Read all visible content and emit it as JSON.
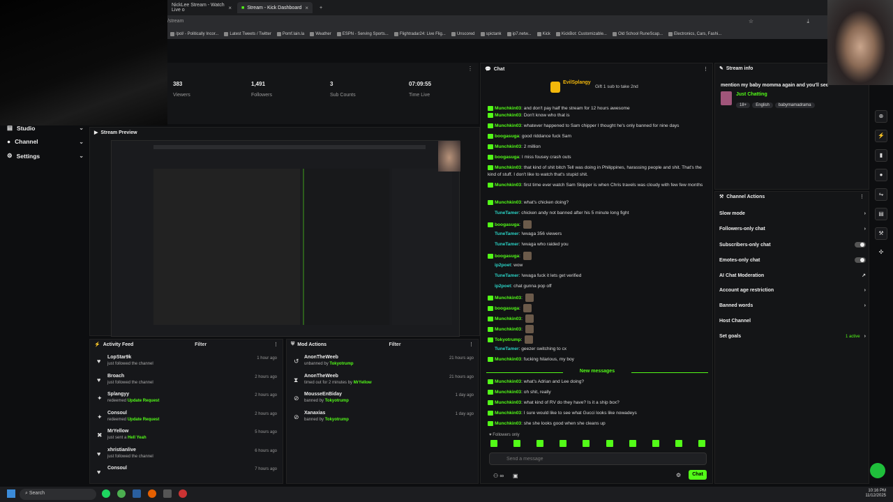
{
  "browser": {
    "tabs": [
      {
        "title": "NickLee Stream - Watch Live o"
      },
      {
        "title": "Stream - Kick Dashboard"
      }
    ],
    "url": "/stream",
    "bookmarks": [
      "/pol/ - Politically Incor...",
      "Latest Tweets / Twitter",
      "Pomf.lain.la",
      "Weather",
      "ESPN - Serving Sports...",
      "Flightradar24: Live Flig...",
      "Unscored",
      "spictank",
      "ip7.netw...",
      "Kick",
      "KickBot: Customizable...",
      "Old School RuneScap...",
      "Electronics, Cars, Fashi..."
    ]
  },
  "sidebar": {
    "items": [
      {
        "label": "Studio"
      },
      {
        "label": "Channel"
      },
      {
        "label": "Settings"
      }
    ]
  },
  "stats": [
    {
      "value": "383",
      "label": "Viewers"
    },
    {
      "value": "1,491",
      "label": "Followers"
    },
    {
      "value": "3",
      "label": "Sub Counts"
    },
    {
      "value": "07:09:55",
      "label": "Time Live"
    }
  ],
  "preview": {
    "title": "Stream Preview"
  },
  "activity": {
    "title": "Activity Feed",
    "filter": "Filter",
    "items": [
      {
        "name": "LopStar9k",
        "action": "just followed the channel",
        "time": "1 hour ago",
        "icon": "heart-icon",
        "glyph": "♥"
      },
      {
        "name": "Broach",
        "action": "just followed the channel",
        "time": "2 hours ago",
        "icon": "heart-icon",
        "glyph": "♥"
      },
      {
        "name": "Splangyy",
        "action": "redeemed",
        "highlight": "Update Request",
        "time": "2 hours ago",
        "icon": "redeem-icon",
        "glyph": "✦"
      },
      {
        "name": "Consoul",
        "action": "redeemed",
        "highlight": "Update Request",
        "time": "2 hours ago",
        "icon": "redeem-icon",
        "glyph": "✦"
      },
      {
        "name": "MrYellow",
        "action": "just sent a",
        "highlight": "Hell Yeah",
        "time": "5 hours ago",
        "icon": "gift-icon",
        "glyph": "✖"
      },
      {
        "name": "xhristianlive",
        "action": "just followed the channel",
        "time": "6 hours ago",
        "icon": "heart-icon",
        "glyph": "♥"
      },
      {
        "name": "Consoul",
        "action": "",
        "time": "7 hours ago",
        "icon": "heart-icon",
        "glyph": "♥"
      }
    ]
  },
  "modactions": {
    "title": "Mod Actions",
    "filter": "Filter",
    "items": [
      {
        "name": "AnonTheWeeb",
        "action": "unbanned by",
        "by": "Tokyotrump",
        "time": "21 hours ago",
        "icon": "undo-icon",
        "glyph": "↺"
      },
      {
        "name": "AnonTheWeeb",
        "action": "timed out for 2 minutes by",
        "by": "MrYellow",
        "time": "21 hours ago",
        "icon": "hourglass-icon",
        "glyph": "⧗"
      },
      {
        "name": "MousseEnBiday",
        "action": "banned by",
        "by": "Tokyotrump",
        "time": "1 day ago",
        "icon": "ban-icon",
        "glyph": "⊘"
      },
      {
        "name": "Xanaxias",
        "action": "banned by",
        "by": "Tokyotrump",
        "time": "1 day ago",
        "icon": "ban-icon",
        "glyph": "⊘"
      }
    ]
  },
  "chat": {
    "title": "Chat",
    "pinned_user": "EvilSplangy",
    "pinned_text": "Gift 1 sub to take 2nd",
    "messages": [
      {
        "user": "Munchkin03",
        "text": "and don't pay half the stream for 12 hours awesome",
        "color": "#53fc18"
      },
      {
        "user": "Munchkin03",
        "text": "Don't know who that is",
        "color": "#53fc18"
      },
      {
        "user": "Munchkin03",
        "text": "whatever happened to Sam chipper I thought he's only banned for nine days",
        "color": "#53fc18"
      },
      {
        "user": "boogasuga",
        "text": "good riddance fuck Sam",
        "color": "#53fc18"
      },
      {
        "user": "Munchkin03",
        "text": "2 million",
        "color": "#53fc18"
      },
      {
        "user": "boogasuga",
        "text": "I miss fousey crash outs",
        "color": "#53fc18"
      },
      {
        "user": "Munchkin03",
        "text": "that kind of shit bitch Tell was doing in Philippines, harassing people and shit. That's the kind of stuff. I don't like to watch that's stupid shit.",
        "color": "#53fc18"
      },
      {
        "user": "Munchkin03",
        "text": "first time ever watch Sam Skipper is when Chris travels was cloudy with few few months",
        "color": "#53fc18"
      },
      {
        "user": "Munchkin03",
        "text": "what's chicken doing?",
        "color": "#53fc18"
      },
      {
        "user": "TuneTamer",
        "text": "chicken andy not banned after his 5 minute long fight",
        "color": "#2bd4c7"
      },
      {
        "user": "boogasuga",
        "text": "",
        "color": "#53fc18"
      },
      {
        "user": "TuneTamer",
        "text": "!wvaga 356 viewers",
        "color": "#2bd4c7"
      },
      {
        "user": "TuneTamer",
        "text": "!wvaga who raided you",
        "color": "#2bd4c7"
      },
      {
        "user": "boogasuga",
        "text": "",
        "color": "#53fc18"
      },
      {
        "user": "ip2poet",
        "text": "wow",
        "color": "#2bd4c7"
      },
      {
        "user": "TuneTamer",
        "text": "!wvaga fuck it lets get verified",
        "color": "#2bd4c7"
      },
      {
        "user": "ip2poet",
        "text": "chat gunna pop off",
        "color": "#2bd4c7"
      },
      {
        "user": "Munchkin03",
        "text": "",
        "color": "#53fc18"
      },
      {
        "user": "boogasuga",
        "text": "",
        "color": "#53fc18"
      },
      {
        "user": "Munchkin03",
        "text": "",
        "color": "#53fc18"
      },
      {
        "user": "Munchkin03",
        "text": "",
        "color": "#53fc18"
      },
      {
        "user": "Tokyotrump",
        "text": "",
        "color": "#53fc18"
      },
      {
        "user": "TuneTamer",
        "text": "geezer switching to cx",
        "color": "#2bd4c7"
      },
      {
        "user": "Munchkin03",
        "text": "fucking hilarious, my boy",
        "color": "#53fc18"
      }
    ],
    "new_label": "New messages",
    "new_messages": [
      {
        "user": "Munchkin03",
        "text": "what's Adrian and Lee doing?",
        "color": "#53fc18"
      },
      {
        "user": "Munchkin03",
        "text": "oh shit, really",
        "color": "#53fc18"
      },
      {
        "user": "Munchkin03",
        "text": "what kind of RV do they have? Is it a ship box?",
        "color": "#53fc18"
      },
      {
        "user": "Munchkin03",
        "text": "I sure would like to see what Gucci looks like nowadeys",
        "color": "#53fc18"
      },
      {
        "user": "Munchkin03",
        "text": "she she looks good when she cleans up",
        "color": "#53fc18"
      }
    ],
    "followers_only": "Followers only",
    "placeholder": "Send a message",
    "send": "Chat"
  },
  "stream_info": {
    "title": "Stream info",
    "stream_title": "mention my baby momma again and you'll see",
    "category": "Just Chatting",
    "tags": [
      "18+",
      "English",
      "babymamadrama"
    ]
  },
  "channel_actions": {
    "title": "Channel Actions",
    "items": [
      {
        "label": "Slow mode",
        "control": "›"
      },
      {
        "label": "Followers-only chat",
        "control": "›"
      },
      {
        "label": "Subscribers-only chat",
        "control": "toggle"
      },
      {
        "label": "Emotes-only chat",
        "control": "toggle"
      },
      {
        "label": "AI Chat Moderation",
        "control": "↗"
      },
      {
        "label": "Account age restriction",
        "control": "›"
      },
      {
        "label": "Banned words",
        "control": "›"
      },
      {
        "label": "Host Channel",
        "control": ""
      },
      {
        "label": "Set goals",
        "control": "›",
        "note": "1 active"
      }
    ]
  },
  "taskbar": {
    "search": "Search",
    "time": "10:16 PM",
    "date": "11/12/2025"
  },
  "colors": {
    "accent": "#53fc18",
    "bg": "#0d0e10",
    "panel": "#141517"
  }
}
